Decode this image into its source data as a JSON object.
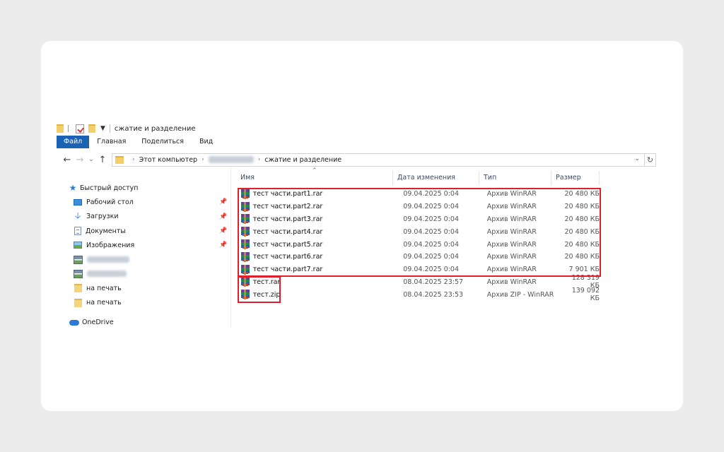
{
  "window": {
    "title": "сжатие и разделение"
  },
  "ribbon": {
    "tabs": [
      "Файл",
      "Главная",
      "Поделиться",
      "Вид"
    ]
  },
  "address": {
    "crumbs": [
      "Этот компьютер",
      "сжатие и разделение"
    ]
  },
  "sidebar": {
    "quick_access": "Быстрый доступ",
    "items": [
      {
        "label": "Рабочий стол",
        "icon": "desktop-icon",
        "pinned": true
      },
      {
        "label": "Загрузки",
        "icon": "download-icon",
        "pinned": true
      },
      {
        "label": "Документы",
        "icon": "documents-icon",
        "pinned": true
      },
      {
        "label": "Изображения",
        "icon": "pictures-icon",
        "pinned": true
      },
      {
        "label": "",
        "icon": "network-drive-icon",
        "pinned": false
      },
      {
        "label": "",
        "icon": "network-drive-icon",
        "pinned": false
      },
      {
        "label": "на печать",
        "icon": "folder-icon",
        "pinned": false
      },
      {
        "label": "на печать",
        "icon": "folder-icon",
        "pinned": false
      }
    ],
    "onedrive": "OneDrive"
  },
  "columns": {
    "name": "Имя",
    "date": "Дата изменения",
    "type": "Тип",
    "size": "Размер"
  },
  "files": [
    {
      "name": "тест части.part1.rar",
      "date": "09.04.2025 0:04",
      "type": "Архив WinRAR",
      "size": "20 480 КБ"
    },
    {
      "name": "тест части.part2.rar",
      "date": "09.04.2025 0:04",
      "type": "Архив WinRAR",
      "size": "20 480 КБ"
    },
    {
      "name": "тест части.part3.rar",
      "date": "09.04.2025 0:04",
      "type": "Архив WinRAR",
      "size": "20 480 КБ"
    },
    {
      "name": "тест части.part4.rar",
      "date": "09.04.2025 0:04",
      "type": "Архив WinRAR",
      "size": "20 480 КБ"
    },
    {
      "name": "тест части.part5.rar",
      "date": "09.04.2025 0:04",
      "type": "Архив WinRAR",
      "size": "20 480 КБ"
    },
    {
      "name": "тест части.part6.rar",
      "date": "09.04.2025 0:04",
      "type": "Архив WinRAR",
      "size": "20 480 КБ"
    },
    {
      "name": "тест части.part7.rar",
      "date": "09.04.2025 0:04",
      "type": "Архив WinRAR",
      "size": "7 901 КБ"
    },
    {
      "name": "тест.rar",
      "date": "08.04.2025 23:57",
      "type": "Архив WinRAR",
      "size": "128 319 КБ"
    },
    {
      "name": "тест.zip",
      "date": "08.04.2025 23:53",
      "type": "Архив ZIP - WinRAR",
      "size": "139 092 КБ"
    }
  ],
  "colors": {
    "accent": "#1a63b3",
    "highlight": "#e01f2b",
    "card": "#ffffff",
    "background": "#ececec"
  }
}
